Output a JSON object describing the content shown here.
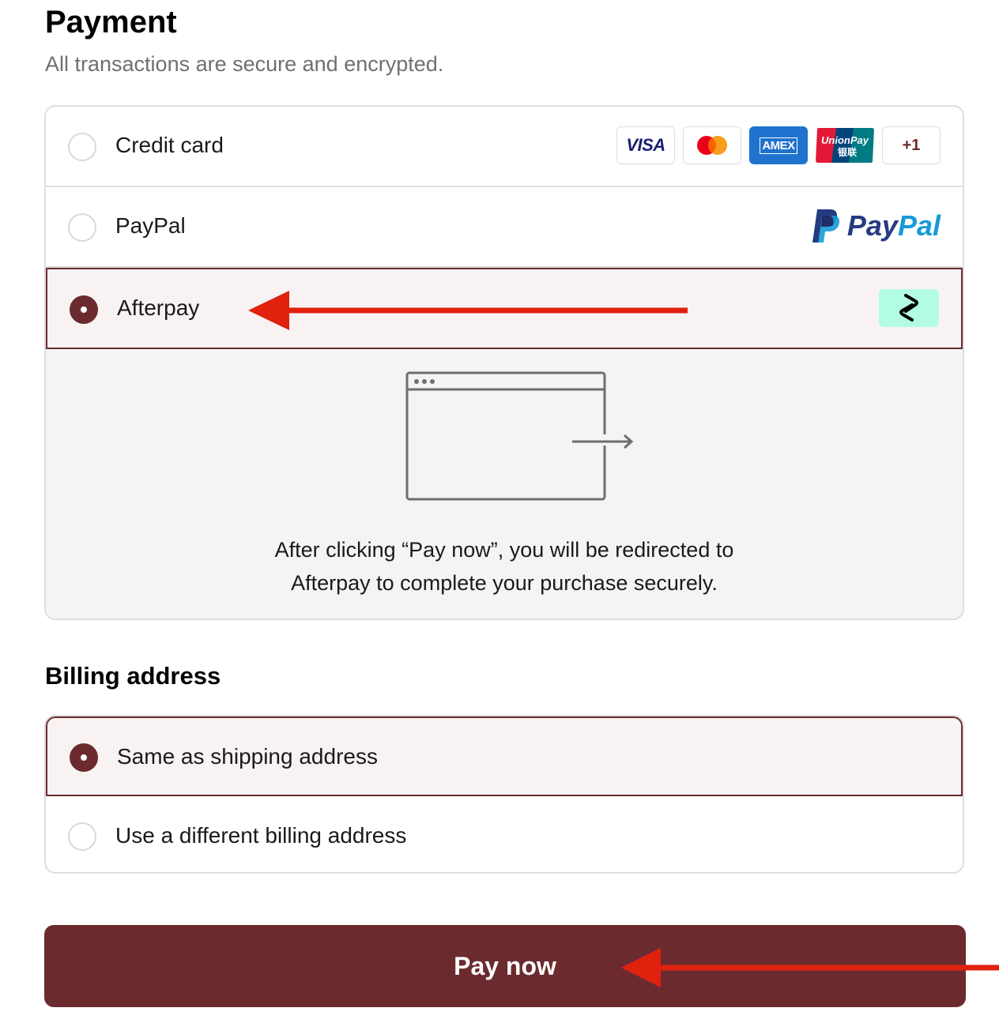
{
  "payment": {
    "title": "Payment",
    "subtitle": "All transactions are secure and encrypted.",
    "methods": [
      {
        "id": "credit-card",
        "label": "Credit card",
        "selected": false,
        "badges": [
          {
            "name": "visa",
            "text": "VISA"
          },
          {
            "name": "mastercard",
            "text": ""
          },
          {
            "name": "amex",
            "text": "AMEX"
          },
          {
            "name": "unionpay",
            "text": "UnionPay",
            "text2": "银联"
          },
          {
            "name": "more",
            "text": "+1"
          }
        ]
      },
      {
        "id": "paypal",
        "label": "PayPal",
        "selected": false,
        "logo_text_1": "Pay",
        "logo_text_2": "Pal"
      },
      {
        "id": "afterpay",
        "label": "Afterpay",
        "selected": true,
        "logo_icon": "afterpay-icon"
      }
    ],
    "afterpay_panel": {
      "line1": "After clicking “Pay now”, you will be redirected to",
      "line2": "Afterpay to complete your purchase securely."
    }
  },
  "billing": {
    "title": "Billing address",
    "options": [
      {
        "id": "same",
        "label": "Same as shipping address",
        "selected": true
      },
      {
        "id": "different",
        "label": "Use a different billing address",
        "selected": false
      }
    ]
  },
  "pay_button": {
    "label": "Pay now"
  },
  "colors": {
    "accent": "#6b2b2e",
    "selected_bg": "#f8f3f2",
    "annotation_arrow": "#e0210e",
    "afterpay_mint": "#b2fce4"
  }
}
